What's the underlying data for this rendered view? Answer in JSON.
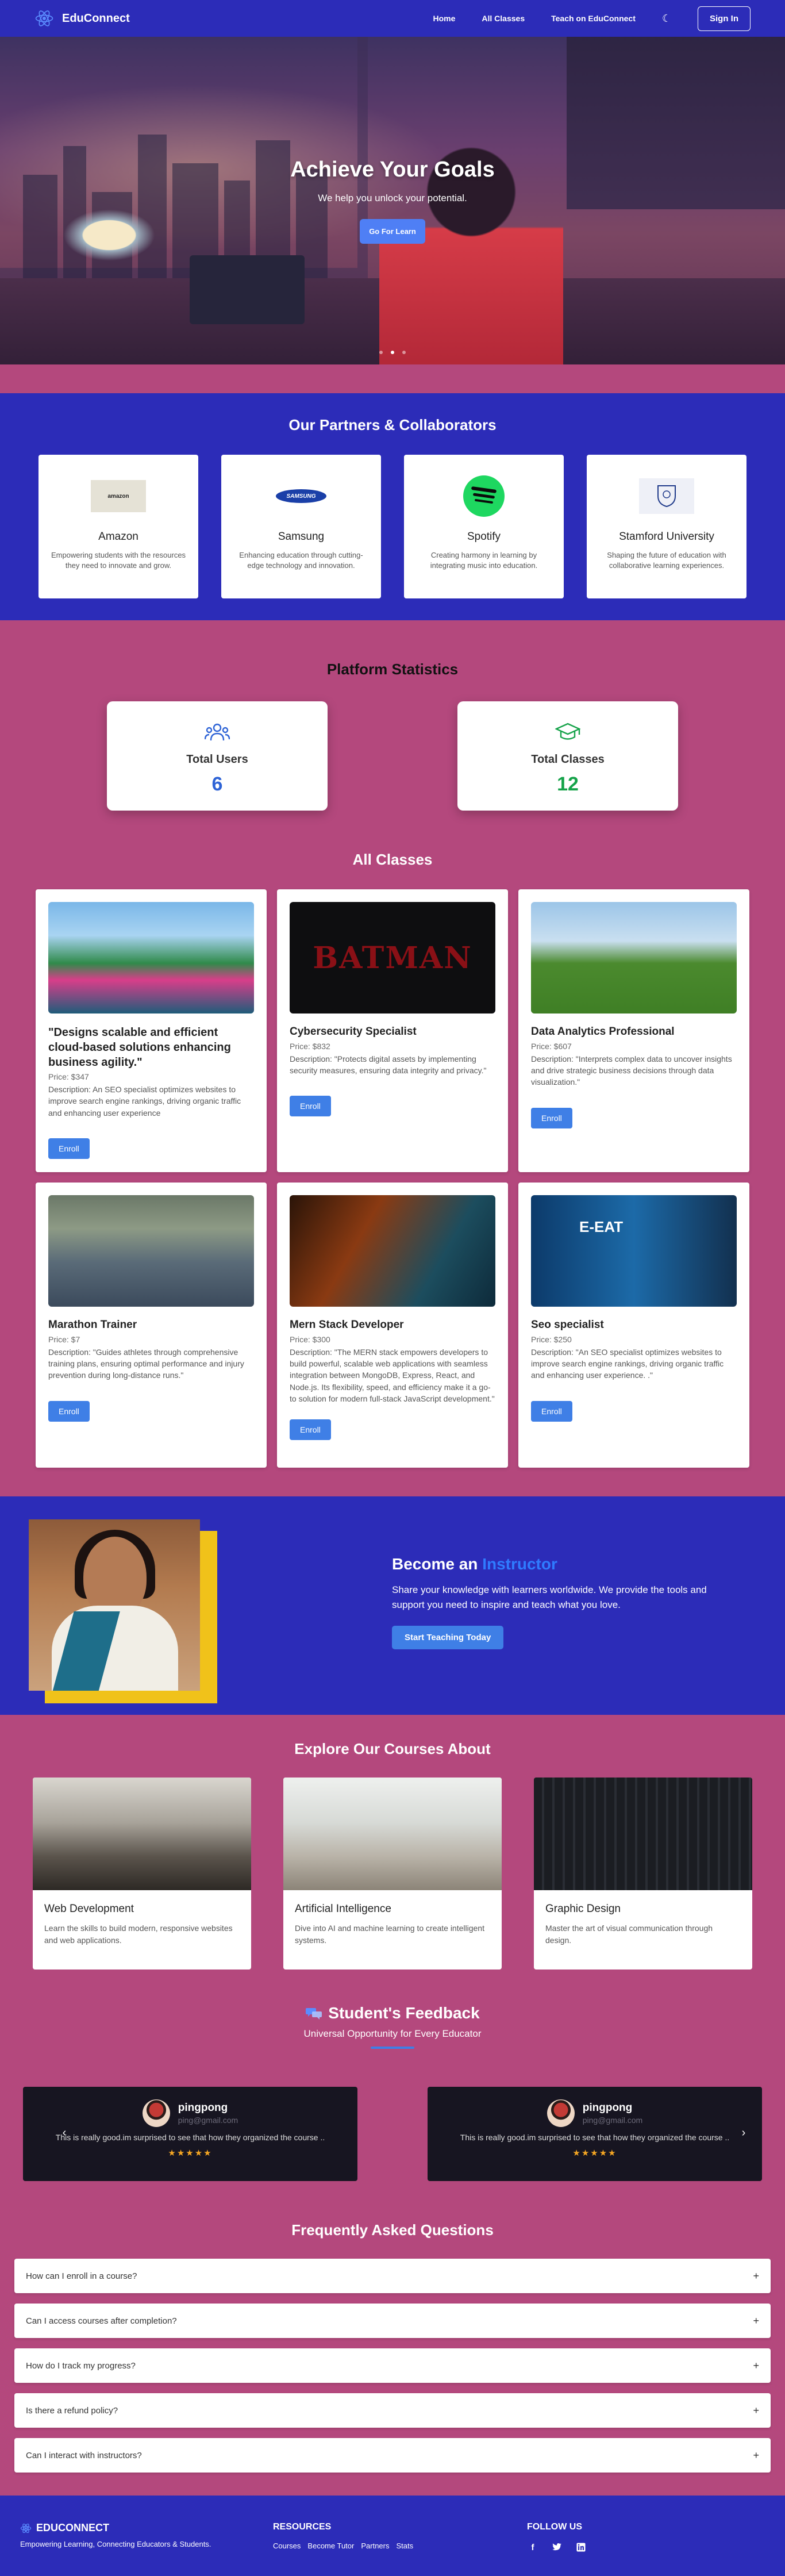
{
  "nav": {
    "brand": "EduConnect",
    "links": [
      "Home",
      "All Classes",
      "Teach on EduConnect"
    ],
    "theme_icon": "moon-icon",
    "signin": "Sign In"
  },
  "hero": {
    "title": "Achieve Your Goals",
    "subtitle": "We help you unlock your potential.",
    "button": "Go For Learn",
    "slides": 3,
    "active_slide": 2
  },
  "partners": {
    "title": "Our Partners & Collaborators",
    "items": [
      {
        "name": "Amazon",
        "logo_text": "amazon",
        "desc": "Empowering students with the resources they need to innovate and grow."
      },
      {
        "name": "Samsung",
        "logo_text": "SAMSUNG",
        "desc": "Enhancing education through cutting-edge technology and innovation."
      },
      {
        "name": "Spotify",
        "logo_text": "",
        "desc": "Creating harmony in learning by integrating music into education."
      },
      {
        "name": "Stamford University",
        "logo_text": "",
        "desc": "Shaping the future of education with collaborative learning experiences."
      }
    ]
  },
  "stats": {
    "title": "Platform Statistics",
    "items": [
      {
        "label": "Total Users",
        "value": "6",
        "color": "#2e63d6"
      },
      {
        "label": "Total Classes",
        "value": "12",
        "color": "#16a34a"
      }
    ]
  },
  "classes": {
    "title": "All Classes",
    "enroll_label": "Enroll",
    "items": [
      {
        "title": "\"Designs scalable and efficient cloud-based solutions enhancing business agility.\"",
        "price": "Price: $347",
        "desc": "Description: An SEO specialist optimizes websites to improve search engine rankings, driving organic traffic and enhancing user experience"
      },
      {
        "title": "Cybersecurity Specialist",
        "price": "Price: $832",
        "desc": "Description: \"Protects digital assets by implementing security measures, ensuring data integrity and privacy.\"",
        "image_text": "BATMAN"
      },
      {
        "title": "Data Analytics Professional",
        "price": "Price: $607",
        "desc": "Description: \"Interprets complex data to uncover insights and drive strategic business decisions through data visualization.\""
      },
      {
        "title": "Marathon Trainer",
        "price": "Price: $7",
        "desc": "Description: \"Guides athletes through comprehensive training plans, ensuring optimal performance and injury prevention during long-distance runs.\""
      },
      {
        "title": "Mern Stack Developer",
        "price": "Price: $300",
        "desc": "Description: \"The MERN stack empowers developers to build powerful, scalable web applications with seamless integration between MongoDB, Express, React, and Node.js. Its flexibility, speed, and efficiency make it a go-to solution for modern full-stack JavaScript development.\""
      },
      {
        "title": "Seo specialist",
        "price": "Price: $250",
        "desc": "Description: \"An SEO specialist optimizes websites to improve search engine rankings, driving organic traffic and enhancing user experience. .\"",
        "image_text": "E-EAT"
      }
    ]
  },
  "instructor": {
    "title_prefix": "Become an",
    "title_highlight": "Instructor",
    "text": "Share your knowledge with learners worldwide. We provide the tools and support you need to inspire and teach what you love.",
    "button": "Start Teaching Today"
  },
  "explore": {
    "title": "Explore Our Courses About",
    "items": [
      {
        "title": "Web Development",
        "desc": "Learn the skills to build modern, responsive websites and web applications."
      },
      {
        "title": "Artificial Intelligence",
        "desc": "Dive into AI and machine learning to create intelligent systems."
      },
      {
        "title": "Graphic Design",
        "desc": "Master the art of visual communication through design."
      }
    ]
  },
  "feedback": {
    "title": "Student's Feedback",
    "subtitle": "Universal Opportunity for Every Educator",
    "items": [
      {
        "name": "pingpong",
        "email": "ping@gmail.com",
        "text": "This is really good.im surprised to see that how they organized the course ..",
        "stars": "★★★★★"
      },
      {
        "name": "pingpong",
        "email": "ping@gmail.com",
        "text": "This is really good.im surprised to see that how they organized the course ..",
        "stars": "★★★★★"
      }
    ]
  },
  "faq": {
    "title": "Frequently Asked Questions",
    "items": [
      "How can I enroll in a course?",
      "Can I access courses after completion?",
      "How do I track my progress?",
      "Is there a refund policy?",
      "Can I interact with instructors?"
    ]
  },
  "footer": {
    "brand": "EDUCONNECT",
    "tagline": "Empowering Learning, Connecting Educators & Students.",
    "resources_head": "RESOURCES",
    "resources": [
      "Courses",
      "Become Tutor",
      "Partners",
      "Stats"
    ],
    "follow_head": "FOLLOW US",
    "social": [
      "facebook-icon",
      "twitter-icon",
      "linkedin-icon"
    ]
  }
}
